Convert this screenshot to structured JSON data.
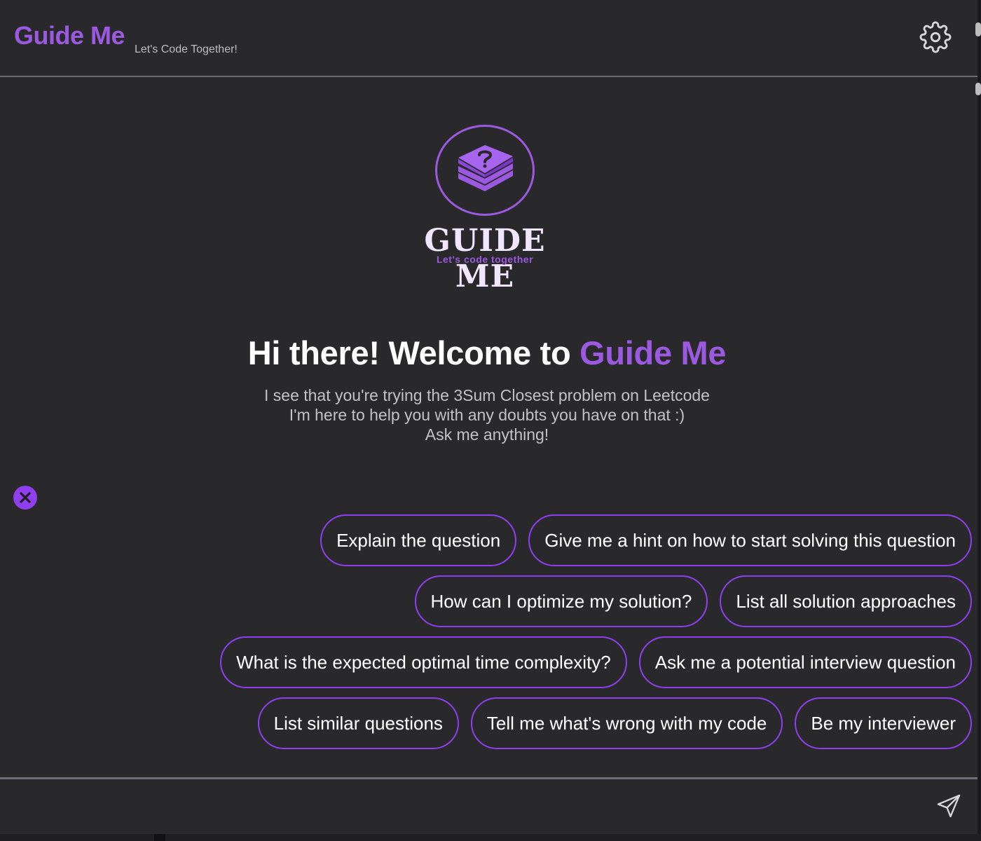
{
  "header": {
    "title": "Guide Me",
    "tagline": "Let's Code Together!"
  },
  "logo": {
    "wordmark": "GUIDE ME",
    "subtitle": "Let's code together"
  },
  "welcome": {
    "prefix": "Hi there! Welcome to ",
    "brand": "Guide Me",
    "lines": [
      "I see that you're trying the 3Sum Closest problem on Leetcode",
      "I'm here to help you with any doubts you have on that :)",
      "Ask me anything!"
    ]
  },
  "suggestions": [
    [
      "Explain the question",
      "Give me a hint on how to start solving this question"
    ],
    [
      "How can I optimize my solution?",
      "List all solution approaches"
    ],
    [
      "What is the expected optimal time complexity?",
      "Ask me a potential interview question"
    ],
    [
      "List similar questions",
      "Tell me what's wrong with my code",
      "Be my interviewer"
    ]
  ],
  "input": {
    "placeholder": ""
  },
  "icons": {
    "settings": "gear-icon",
    "close": "close-icon",
    "send": "send-icon",
    "logo": "book-stack-question-icon"
  },
  "colors": {
    "accent": "#9b59e0",
    "chip_border": "#8f3ff0",
    "background": "#29292b"
  }
}
